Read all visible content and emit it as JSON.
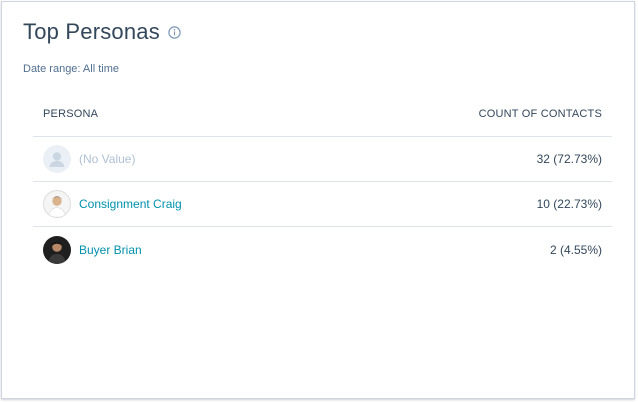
{
  "card": {
    "title": "Top Personas",
    "date_range": "Date range: All time"
  },
  "table": {
    "columns": [
      "PERSONA",
      "COUNT OF CONTACTS"
    ],
    "rows": [
      {
        "persona": "(No Value)",
        "count": "32 (72.73%)",
        "avatar": "default-user-icon"
      },
      {
        "persona": "Consignment Craig",
        "count": "10 (22.73%)",
        "avatar": "photo"
      },
      {
        "persona": "Buyer Brian",
        "count": "2 (4.55%)",
        "avatar": "photo"
      }
    ]
  },
  "colors": {
    "link": "#0091ae",
    "text": "#33475b",
    "muted": "#b0c1d4",
    "border": "#dfe3eb"
  }
}
